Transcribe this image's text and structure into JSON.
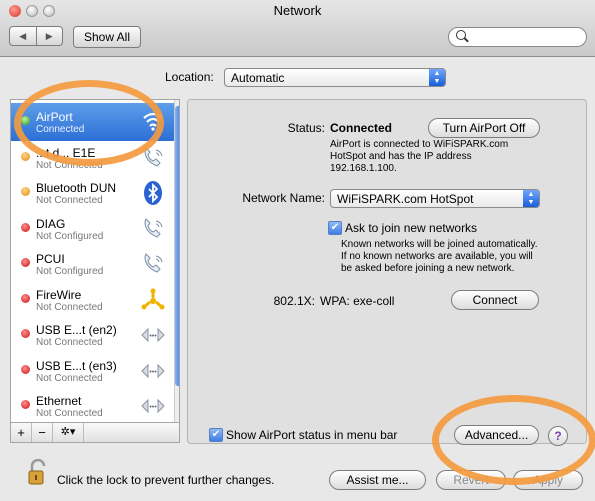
{
  "window": {
    "title": "Network"
  },
  "toolbar": {
    "back": "◀",
    "forward": "▶",
    "show_all": "Show All",
    "search_placeholder": ""
  },
  "location": {
    "label": "Location:",
    "value": "Automatic"
  },
  "services": [
    {
      "name": "AirPort",
      "status": "Connected",
      "dot": "green",
      "icon": "wifi-icon",
      "selected": true
    },
    {
      "name": "...t d... E1E",
      "status": "Not Connected",
      "dot": "orange",
      "icon": "phone-icon"
    },
    {
      "name": "Bluetooth DUN",
      "status": "Not Connected",
      "dot": "orange",
      "icon": "bluetooth-icon"
    },
    {
      "name": "DIAG",
      "status": "Not Configured",
      "dot": "red",
      "icon": "phone-icon"
    },
    {
      "name": "PCUI",
      "status": "Not Configured",
      "dot": "red",
      "icon": "phone-icon"
    },
    {
      "name": "FireWire",
      "status": "Not Connected",
      "dot": "red",
      "icon": "firewire-icon"
    },
    {
      "name": "USB E...t (en2)",
      "status": "Not Connected",
      "dot": "red",
      "icon": "ethernet-icon"
    },
    {
      "name": "USB E...t (en3)",
      "status": "Not Connected",
      "dot": "red",
      "icon": "ethernet-icon"
    },
    {
      "name": "Ethernet",
      "status": "Not Connected",
      "dot": "red",
      "icon": "ethernet-icon"
    }
  ],
  "list_controls": {
    "add": "+",
    "remove": "−",
    "gear": "✲▾"
  },
  "detail": {
    "status_label": "Status:",
    "status_value": "Connected",
    "turn_off_button": "Turn AirPort Off",
    "status_desc_1": "AirPort is connected to WiFiSPARK.com",
    "status_desc_2": "HotSpot and has the IP address",
    "status_desc_3": "192.168.1.100.",
    "network_name_label": "Network Name:",
    "network_name_value": "WiFiSPARK.com HotSpot",
    "ask_join_label": "Ask to join new networks",
    "ask_join_desc_1": "Known networks will be joined automatically.",
    "ask_join_desc_2": "If no known networks are available, you will",
    "ask_join_desc_3": "be asked before joining a new network.",
    "dot1x_label": "802.1X:",
    "dot1x_value": "WPA: exe-coll",
    "connect_button": "Connect",
    "show_status_label": "Show AirPort status in menu bar",
    "advanced_button": "Advanced...",
    "help": "?"
  },
  "footer": {
    "lock_text": "Click the lock to prevent further changes.",
    "assist_button": "Assist me...",
    "revert_button": "Revert",
    "apply_button": "Apply"
  },
  "colors": {
    "annotation_circle": "#f39a3e",
    "selection": "#3b7ddb"
  }
}
